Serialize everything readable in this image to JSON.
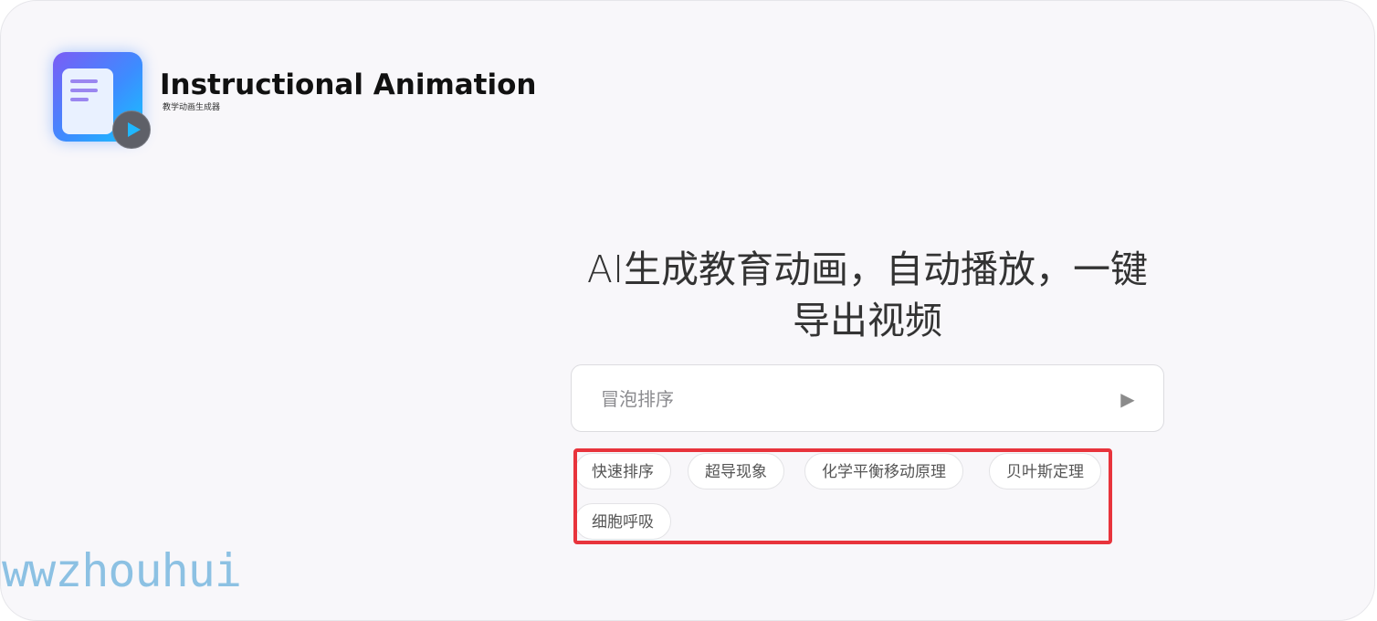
{
  "brand": {
    "title": "Instructional Animation",
    "subtitle": "教学动画生成器",
    "logo_icon": "document-play-icon"
  },
  "hero": {
    "headline": "AI生成教育动画，自动播放，一键导出视频"
  },
  "search": {
    "placeholder": "冒泡排序",
    "value": "",
    "send_icon": "play-triangle-icon",
    "send_label": "▶"
  },
  "suggestions": [
    {
      "label": "快速排序"
    },
    {
      "label": "超导现象"
    },
    {
      "label": "化学平衡移动原理"
    },
    {
      "label": "贝叶斯定理"
    },
    {
      "label": "细胞呼吸"
    }
  ],
  "annotation": {
    "highlight_color": "#e8343c"
  },
  "watermark": {
    "text": "wwzhouhui"
  },
  "colors": {
    "background": "#f8f7fa",
    "logo_gradient_start": "#7b5cf5",
    "logo_gradient_end": "#14c6ff",
    "watermark": "#7ab8e0"
  }
}
